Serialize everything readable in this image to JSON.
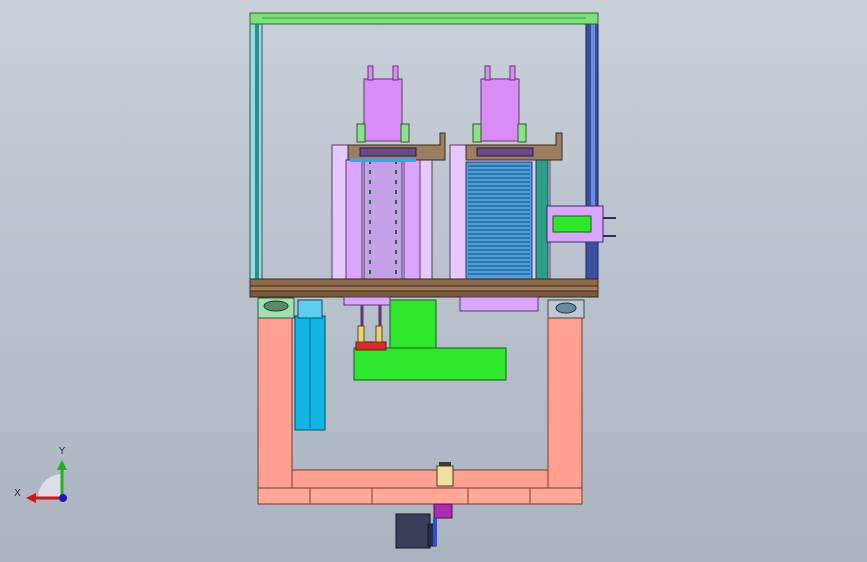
{
  "view": {
    "background_top": "#c9d0d9",
    "background_bottom": "#aab4c0"
  },
  "triad": {
    "x_label": "X",
    "y_label": "Y",
    "x_color": "#d01818",
    "y_color": "#18b818",
    "z_color": "#1818c8"
  },
  "parts": {
    "frame_color": "#2a8f8f",
    "top_beam_color": "#7ce07c",
    "base_plate_color": "#8a6a4a",
    "pink_base_color": "#ff9f90",
    "column_violet": "#d9a6ff",
    "motor_violet": "#d98cf5",
    "green_block": "#2ee82e",
    "blue_rack": "#4aa0dc",
    "cyan_wheel": "#10b6e0",
    "motor_dark": "#3a3f58"
  }
}
